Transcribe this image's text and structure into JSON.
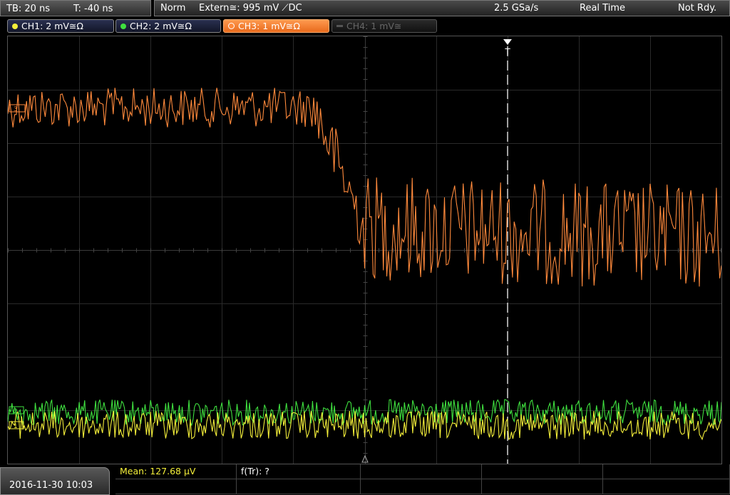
{
  "timebase": {
    "tb": "TB: 20 ns",
    "trigger_time": "T: -40 ns"
  },
  "acquisition": {
    "mode": "Norm",
    "trigger_source": "Extern≅: 995 mV ⟋DC",
    "sample_rate": "2.5 GSa/s",
    "run_mode": "Real Time",
    "status": "Not Rdy."
  },
  "channels": [
    {
      "label": "CH1: 2 mV≅Ω",
      "color": "#f4ef3a",
      "active": false,
      "enabled": true
    },
    {
      "label": "CH2: 2 mV≅Ω",
      "color": "#3fe03f",
      "active": false,
      "enabled": true
    },
    {
      "label": "CH3: 1 mV≅Ω",
      "color": "#ff8a3c",
      "active": true,
      "enabled": true
    },
    {
      "label": "CH4: 1 mV≅",
      "color": "#666666",
      "active": false,
      "enabled": false
    }
  ],
  "markers": {
    "trigger": "T",
    "ch3": "3",
    "ch2": "2",
    "ch1": "1"
  },
  "measurement": {
    "mean": "Mean: 127.68 µV",
    "f_tr": "f(Tr): ?"
  },
  "datetime": "2016-11-30 10:03"
}
